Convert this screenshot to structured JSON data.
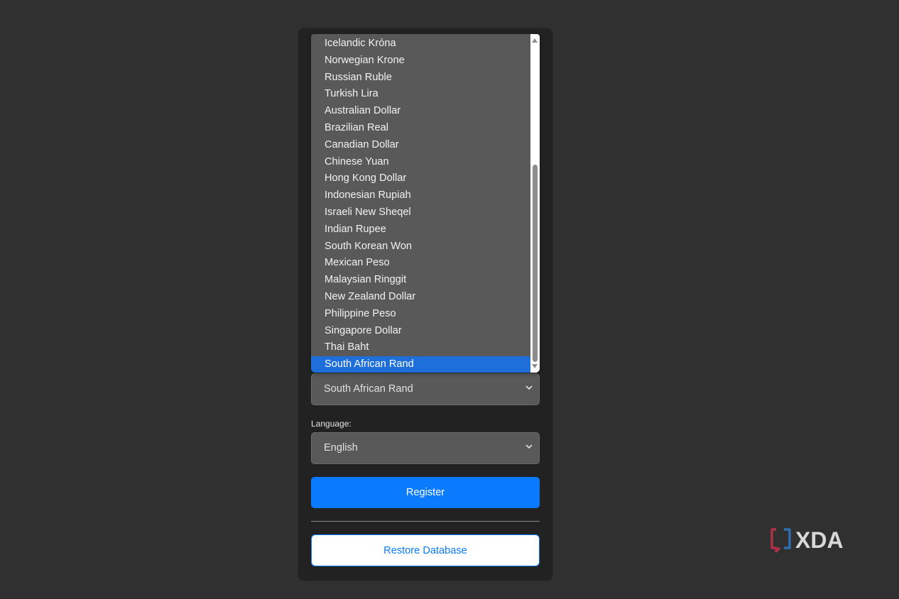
{
  "currency": {
    "options": [
      "Icelandic Króna",
      "Norwegian Krone",
      "Russian Ruble",
      "Turkish Lira",
      "Australian Dollar",
      "Brazilian Real",
      "Canadian Dollar",
      "Chinese Yuan",
      "Hong Kong Dollar",
      "Indonesian Rupiah",
      "Israeli New Sheqel",
      "Indian Rupee",
      "South Korean Won",
      "Mexican Peso",
      "Malaysian Ringgit",
      "New Zealand Dollar",
      "Philippine Peso",
      "Singapore Dollar",
      "Thai Baht",
      "South African Rand"
    ],
    "selected_index": 19,
    "selected_value": "South African Rand"
  },
  "language": {
    "label": "Language:",
    "selected_value": "English"
  },
  "buttons": {
    "register": "Register",
    "restore": "Restore Database"
  },
  "watermark": {
    "text": "XDA"
  },
  "colors": {
    "accent": "#0a7bff",
    "highlight": "#1e6fd9",
    "background": "#303030",
    "card": "#222222",
    "control": "#595959"
  },
  "icons": {
    "select_arrow": "chevron-down-icon",
    "scroll_up": "scroll-up-arrow-icon",
    "scroll_down": "scroll-down-arrow-icon"
  }
}
